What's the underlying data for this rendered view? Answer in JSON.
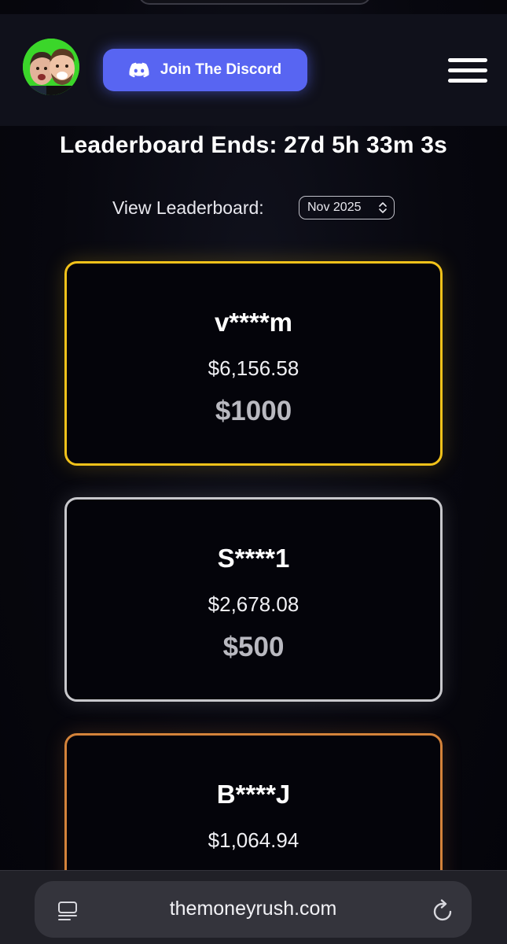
{
  "header": {
    "avatar_icon": "streamers-avatar",
    "discord_button": {
      "label": "Join The Discord",
      "icon": "discord-icon",
      "color": "#5865f2"
    },
    "menu_icon": "hamburger-menu-icon"
  },
  "countdown": {
    "text": "Leaderboard Ends: 27d 5h 33m 3s"
  },
  "leaderboard_selector": {
    "label": "View Leaderboard:",
    "selected": "Nov 2025"
  },
  "leaderboard": {
    "entries": [
      {
        "name": "v****m",
        "wagered": "$6,156.58",
        "prize": "$1000",
        "border_color": "#f2c21a"
      },
      {
        "name": "S****1",
        "wagered": "$2,678.08",
        "prize": "$500",
        "border_color": "#c8c8cc"
      },
      {
        "name": "B****J",
        "wagered": "$1,064.94",
        "prize": "",
        "border_color": "#d4833a"
      }
    ]
  },
  "browser": {
    "url": "themoneyrush.com",
    "reader_icon": "reader-mode-icon",
    "reload_icon": "reload-icon"
  }
}
